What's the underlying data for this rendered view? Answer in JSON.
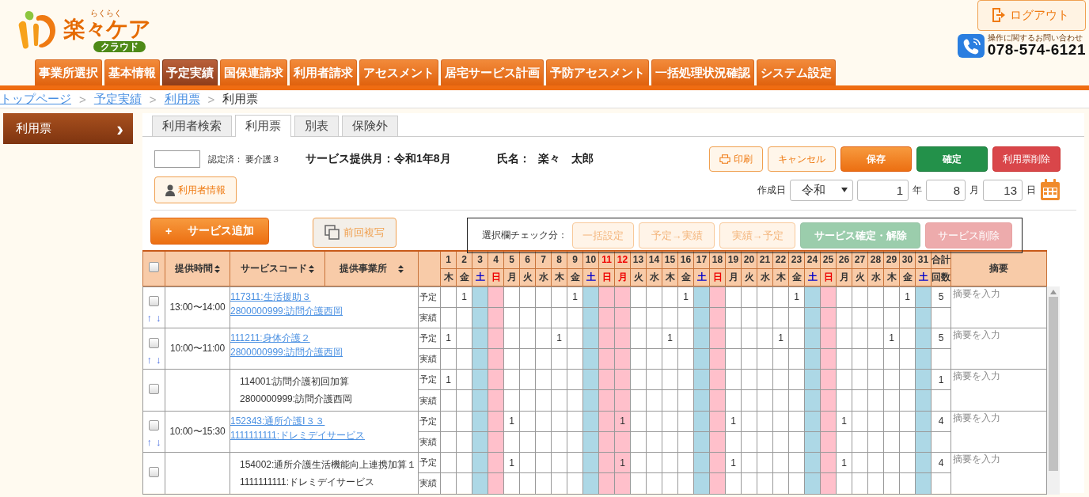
{
  "logo": {
    "name": "楽々ケア",
    "ruby": "らくらく",
    "badge": "クラウド"
  },
  "logout": "ログアウト",
  "contact": {
    "caption": "操作に関するお問い合わせ",
    "phone": "078-574-6121"
  },
  "nav": [
    {
      "label": "事業所選択",
      "selected": false
    },
    {
      "label": "基本情報",
      "selected": false
    },
    {
      "label": "予定実績",
      "selected": true
    },
    {
      "label": "国保連請求",
      "selected": false
    },
    {
      "label": "利用者請求",
      "selected": false
    },
    {
      "label": "アセスメント",
      "selected": false
    },
    {
      "label": "居宅サービス計画",
      "selected": false
    },
    {
      "label": "予防アセスメント",
      "selected": false
    },
    {
      "label": "一括処理状況確認",
      "selected": false
    },
    {
      "label": "システム設定",
      "selected": false
    }
  ],
  "breadcrumb": [
    {
      "label": "トップページ",
      "link": true
    },
    {
      "label": "予定実績",
      "link": true
    },
    {
      "label": "利用票",
      "link": true
    },
    {
      "label": "利用票",
      "link": false
    }
  ],
  "breadcrumb_separator": ">",
  "sidebar": {
    "items": [
      {
        "label": "利用票",
        "selected": true,
        "chevron": "›"
      }
    ]
  },
  "tabs": [
    {
      "label": "利用者検索",
      "selected": false
    },
    {
      "label": "利用票",
      "selected": true
    },
    {
      "label": "別表",
      "selected": false
    },
    {
      "label": "保険外",
      "selected": false
    }
  ],
  "header_info": {
    "certification": "認定済： 要介護３",
    "service_month": "サービス提供月：令和1年8月",
    "name_label": "氏名：",
    "name": "楽々　太郎"
  },
  "actions": [
    {
      "label": "印刷",
      "kind": "outline",
      "disabled": false
    },
    {
      "label": "キャンセル",
      "kind": "outline",
      "disabled": false
    },
    {
      "label": "保存",
      "kind": "primary",
      "disabled": false
    },
    {
      "label": "確定",
      "kind": "success",
      "disabled": false
    },
    {
      "label": "利用票削除",
      "kind": "danger",
      "disabled": false
    }
  ],
  "user_info_button": "利用者情報",
  "created_date": {
    "label": "作成日",
    "era": "令和",
    "year": "1",
    "year_unit": "年",
    "month": "8",
    "month_unit": "月",
    "day": "13",
    "day_unit": "日"
  },
  "add_service": {
    "plus": "+",
    "label": "サービス追加"
  },
  "copy_previous": {
    "label": "前回複写",
    "disabled": true
  },
  "bulk": {
    "label": "選択欄チェック分：",
    "buttons": [
      {
        "label": "一括設定",
        "kind": "outline",
        "disabled": true
      },
      {
        "label": "予定→実績",
        "kind": "outline",
        "disabled": true
      },
      {
        "label": "実績→予定",
        "kind": "outline",
        "disabled": true
      },
      {
        "label": "サービス確定・解除",
        "kind": "success",
        "disabled": true
      },
      {
        "label": "サービス削除",
        "kind": "danger",
        "disabled": true
      }
    ]
  },
  "table": {
    "select_all": {
      "checked": false
    },
    "columns": {
      "time": "提供時間",
      "code": "サービスコード",
      "office": "提供事業所",
      "total_top": "合計",
      "total_bottom": "回数",
      "memo": "摘要"
    },
    "days": [
      {
        "day": "1",
        "weekday": "木",
        "kind": "weekday"
      },
      {
        "day": "2",
        "weekday": "金",
        "kind": "weekday"
      },
      {
        "day": "3",
        "weekday": "土",
        "kind": "saturday"
      },
      {
        "day": "4",
        "weekday": "日",
        "kind": "sunday"
      },
      {
        "day": "5",
        "weekday": "月",
        "kind": "weekday"
      },
      {
        "day": "6",
        "weekday": "火",
        "kind": "weekday"
      },
      {
        "day": "7",
        "weekday": "水",
        "kind": "weekday"
      },
      {
        "day": "8",
        "weekday": "木",
        "kind": "weekday"
      },
      {
        "day": "9",
        "weekday": "金",
        "kind": "weekday"
      },
      {
        "day": "10",
        "weekday": "土",
        "kind": "saturday"
      },
      {
        "day": "11",
        "weekday": "日",
        "kind": "holiday"
      },
      {
        "day": "12",
        "weekday": "月",
        "kind": "holiday"
      },
      {
        "day": "13",
        "weekday": "火",
        "kind": "weekday"
      },
      {
        "day": "14",
        "weekday": "水",
        "kind": "weekday"
      },
      {
        "day": "15",
        "weekday": "木",
        "kind": "weekday"
      },
      {
        "day": "16",
        "weekday": "金",
        "kind": "weekday"
      },
      {
        "day": "17",
        "weekday": "土",
        "kind": "saturday"
      },
      {
        "day": "18",
        "weekday": "日",
        "kind": "sunday"
      },
      {
        "day": "19",
        "weekday": "月",
        "kind": "weekday"
      },
      {
        "day": "20",
        "weekday": "火",
        "kind": "weekday"
      },
      {
        "day": "21",
        "weekday": "水",
        "kind": "weekday"
      },
      {
        "day": "22",
        "weekday": "木",
        "kind": "weekday"
      },
      {
        "day": "23",
        "weekday": "金",
        "kind": "weekday"
      },
      {
        "day": "24",
        "weekday": "土",
        "kind": "saturday"
      },
      {
        "day": "25",
        "weekday": "日",
        "kind": "sunday"
      },
      {
        "day": "26",
        "weekday": "月",
        "kind": "weekday"
      },
      {
        "day": "27",
        "weekday": "火",
        "kind": "weekday"
      },
      {
        "day": "28",
        "weekday": "水",
        "kind": "weekday"
      },
      {
        "day": "29",
        "weekday": "木",
        "kind": "weekday"
      },
      {
        "day": "30",
        "weekday": "金",
        "kind": "weekday"
      },
      {
        "day": "31",
        "weekday": "土",
        "kind": "saturday"
      }
    ],
    "rows": [
      {
        "kind": "service",
        "checked": false,
        "up": "↑",
        "down": "↓",
        "time": "13:00〜14:00",
        "code": "117311:生活援助３",
        "office": "2800000999:訪問介護西岡",
        "plan_label": "予定",
        "actual_label": "実績",
        "total": "5",
        "memo_placeholder": "摘要を入力",
        "plan": [
          {
            "kind": "blank"
          },
          {
            "kind": "count",
            "count": "1"
          },
          {
            "kind": "blank"
          },
          {
            "kind": "blank"
          },
          {
            "kind": "blank"
          },
          {
            "kind": "blank"
          },
          {
            "kind": "blank"
          },
          {
            "kind": "blank"
          },
          {
            "kind": "count",
            "count": "1"
          },
          {
            "kind": "blank"
          },
          {
            "kind": "blank"
          },
          {
            "kind": "blank"
          },
          {
            "kind": "blank"
          },
          {
            "kind": "blank"
          },
          {
            "kind": "blank"
          },
          {
            "kind": "count",
            "count": "1"
          },
          {
            "kind": "blank"
          },
          {
            "kind": "blank"
          },
          {
            "kind": "blank"
          },
          {
            "kind": "blank"
          },
          {
            "kind": "blank"
          },
          {
            "kind": "blank"
          },
          {
            "kind": "count",
            "count": "1"
          },
          {
            "kind": "blank"
          },
          {
            "kind": "blank"
          },
          {
            "kind": "blank"
          },
          {
            "kind": "blank"
          },
          {
            "kind": "blank"
          },
          {
            "kind": "blank"
          },
          {
            "kind": "count",
            "count": "1"
          },
          {
            "kind": "blank"
          }
        ]
      },
      {
        "kind": "service",
        "checked": false,
        "up": "↑",
        "down": "↓",
        "time": "10:00〜11:00",
        "code": "111211:身体介護２",
        "office": "2800000999:訪問介護西岡",
        "plan_label": "予定",
        "actual_label": "実績",
        "total": "5",
        "memo_placeholder": "摘要を入力",
        "plan": [
          {
            "kind": "count",
            "count": "1"
          },
          {
            "kind": "blank"
          },
          {
            "kind": "blank"
          },
          {
            "kind": "blank"
          },
          {
            "kind": "blank"
          },
          {
            "kind": "blank"
          },
          {
            "kind": "blank"
          },
          {
            "kind": "count",
            "count": "1"
          },
          {
            "kind": "blank"
          },
          {
            "kind": "blank"
          },
          {
            "kind": "blank"
          },
          {
            "kind": "blank"
          },
          {
            "kind": "blank"
          },
          {
            "kind": "blank"
          },
          {
            "kind": "count",
            "count": "1"
          },
          {
            "kind": "blank"
          },
          {
            "kind": "blank"
          },
          {
            "kind": "blank"
          },
          {
            "kind": "blank"
          },
          {
            "kind": "blank"
          },
          {
            "kind": "blank"
          },
          {
            "kind": "count",
            "count": "1"
          },
          {
            "kind": "blank"
          },
          {
            "kind": "blank"
          },
          {
            "kind": "blank"
          },
          {
            "kind": "blank"
          },
          {
            "kind": "blank"
          },
          {
            "kind": "blank"
          },
          {
            "kind": "count",
            "count": "1"
          },
          {
            "kind": "blank"
          },
          {
            "kind": "blank"
          }
        ]
      },
      {
        "kind": "addition",
        "checked": false,
        "code": "114001:訪問介護初回加算",
        "office": "2800000999:訪問介護西岡",
        "plan_label": "予定",
        "actual_label": "実績",
        "total": "1",
        "memo_placeholder": "摘要を入力",
        "plan": [
          {
            "kind": "count",
            "count": "1"
          },
          {
            "kind": "blank"
          },
          {
            "kind": "blank"
          },
          {
            "kind": "blank"
          },
          {
            "kind": "blank"
          },
          {
            "kind": "blank"
          },
          {
            "kind": "blank"
          },
          {
            "kind": "blank"
          },
          {
            "kind": "blank"
          },
          {
            "kind": "blank"
          },
          {
            "kind": "blank"
          },
          {
            "kind": "blank"
          },
          {
            "kind": "blank"
          },
          {
            "kind": "blank"
          },
          {
            "kind": "blank"
          },
          {
            "kind": "blank"
          },
          {
            "kind": "blank"
          },
          {
            "kind": "blank"
          },
          {
            "kind": "blank"
          },
          {
            "kind": "blank"
          },
          {
            "kind": "blank"
          },
          {
            "kind": "blank"
          },
          {
            "kind": "blank"
          },
          {
            "kind": "blank"
          },
          {
            "kind": "blank"
          },
          {
            "kind": "blank"
          },
          {
            "kind": "blank"
          },
          {
            "kind": "blank"
          },
          {
            "kind": "blank"
          },
          {
            "kind": "blank"
          },
          {
            "kind": "blank"
          }
        ]
      },
      {
        "kind": "service",
        "checked": false,
        "up": "↑",
        "down": "↓",
        "time": "10:00〜15:30",
        "code": "152343:通所介護Ⅰ３３",
        "office": "1111111111:ドレミデイサービス",
        "plan_label": "予定",
        "actual_label": "実績",
        "total": "4",
        "memo_placeholder": "摘要を入力",
        "plan": [
          {
            "kind": "blank"
          },
          {
            "kind": "blank"
          },
          {
            "kind": "blank"
          },
          {
            "kind": "blank"
          },
          {
            "kind": "count",
            "count": "1"
          },
          {
            "kind": "blank"
          },
          {
            "kind": "blank"
          },
          {
            "kind": "blank"
          },
          {
            "kind": "blank"
          },
          {
            "kind": "blank"
          },
          {
            "kind": "blank"
          },
          {
            "kind": "count",
            "count": "1"
          },
          {
            "kind": "blank"
          },
          {
            "kind": "blank"
          },
          {
            "kind": "blank"
          },
          {
            "kind": "blank"
          },
          {
            "kind": "blank"
          },
          {
            "kind": "blank"
          },
          {
            "kind": "count",
            "count": "1"
          },
          {
            "kind": "blank"
          },
          {
            "kind": "blank"
          },
          {
            "kind": "blank"
          },
          {
            "kind": "blank"
          },
          {
            "kind": "blank"
          },
          {
            "kind": "blank"
          },
          {
            "kind": "count",
            "count": "1"
          },
          {
            "kind": "blank"
          },
          {
            "kind": "blank"
          },
          {
            "kind": "blank"
          },
          {
            "kind": "blank"
          },
          {
            "kind": "blank"
          }
        ]
      },
      {
        "kind": "addition",
        "checked": false,
        "code": "154002:通所介護生活機能向上連携加算１",
        "office": "1111111111:ドレミデイサービス",
        "plan_label": "予定",
        "actual_label": "実績",
        "total": "4",
        "memo_placeholder": "摘要を入力",
        "plan": [
          {
            "kind": "blank"
          },
          {
            "kind": "blank"
          },
          {
            "kind": "blank"
          },
          {
            "kind": "blank"
          },
          {
            "kind": "count",
            "count": "1"
          },
          {
            "kind": "blank"
          },
          {
            "kind": "blank"
          },
          {
            "kind": "blank"
          },
          {
            "kind": "blank"
          },
          {
            "kind": "blank"
          },
          {
            "kind": "blank"
          },
          {
            "kind": "count",
            "count": "1"
          },
          {
            "kind": "blank"
          },
          {
            "kind": "blank"
          },
          {
            "kind": "blank"
          },
          {
            "kind": "blank"
          },
          {
            "kind": "blank"
          },
          {
            "kind": "blank"
          },
          {
            "kind": "count",
            "count": "1"
          },
          {
            "kind": "blank"
          },
          {
            "kind": "blank"
          },
          {
            "kind": "blank"
          },
          {
            "kind": "blank"
          },
          {
            "kind": "blank"
          },
          {
            "kind": "blank"
          },
          {
            "kind": "count",
            "count": "1"
          },
          {
            "kind": "blank"
          },
          {
            "kind": "blank"
          },
          {
            "kind": "blank"
          },
          {
            "kind": "blank"
          },
          {
            "kind": "blank"
          }
        ]
      }
    ]
  }
}
